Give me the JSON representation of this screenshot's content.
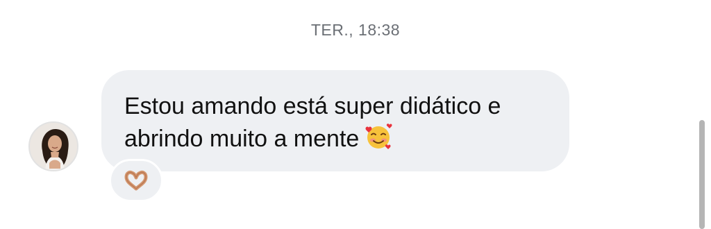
{
  "thread": {
    "timestamp": "TER., 18:38"
  },
  "message": {
    "line1": "Estou amando está super didático e",
    "line2": "abrindo muito a mente",
    "emoji_icon": "smiling-face-with-hearts-icon",
    "reaction_icon": "heart-hands-icon",
    "sender_avatar_icon": "avatar"
  },
  "colors": {
    "bubble": "#eef0f3",
    "timestamp_text": "#6b6f75",
    "message_text": "#111111"
  }
}
